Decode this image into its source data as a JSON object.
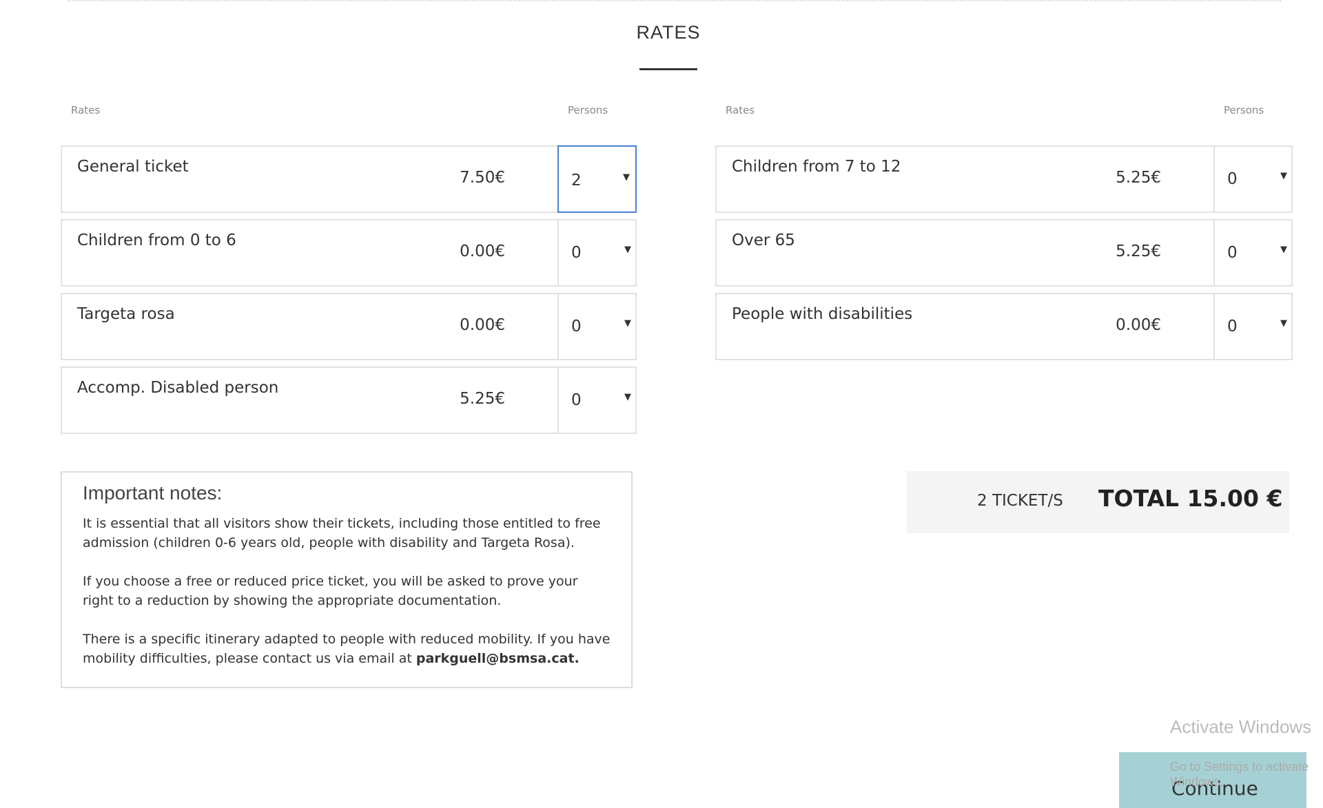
{
  "title": "RATES",
  "left": {
    "header_rates": "Rates",
    "header_persons": "Persons",
    "rows": [
      {
        "name": "General ticket",
        "price": "7.50€",
        "persons": "2"
      },
      {
        "name": "Children from 0 to 6",
        "price": "0.00€",
        "persons": "0"
      },
      {
        "name": "Targeta rosa",
        "price": "0.00€",
        "persons": "0"
      },
      {
        "name": "Accomp. Disabled person",
        "price": "5.25€",
        "persons": "0"
      }
    ]
  },
  "right": {
    "header_rates": "Rates",
    "header_persons": "Persons",
    "rows": [
      {
        "name": "Children from 7 to 12",
        "price": "5.25€",
        "persons": "0"
      },
      {
        "name": "Over 65",
        "price": "5.25€",
        "persons": "0"
      },
      {
        "name": "People with disabilities",
        "price": "0.00€",
        "persons": "0"
      }
    ]
  },
  "notes": {
    "title": "Important notes:",
    "p1": "It is essential that all visitors show their tickets, including those entitled to free admission (children 0-6 years old, people with disability and Targeta Rosa).",
    "p2": "If you choose a free or reduced price ticket, you will be asked to prove your right to a reduction by showing the appropriate documentation.",
    "p3": "There is a specific itinerary adapted to people with reduced mobility. If you have mobility difficulties, please contact us via email at ",
    "email": "parkguell@bsmsa.cat."
  },
  "summary": {
    "tickets": "2 TICKET/S",
    "total": "TOTAL 15.00 €"
  },
  "continue_label": "Continue",
  "watermark": {
    "line1": "Activate Windows",
    "line2": "Go to Settings to activate Windows."
  },
  "colors": {
    "accent": "#a6d1d4",
    "focus": "#4a7fd6",
    "summary_bg": "#f4f4f4"
  }
}
